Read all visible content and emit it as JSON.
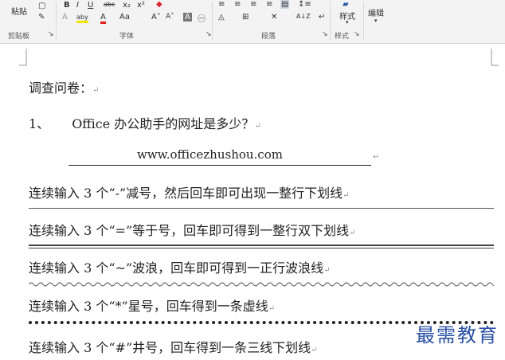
{
  "ribbon": {
    "paste_label": "粘贴",
    "clipboard_group": "剪贴板",
    "font_group": "字体",
    "paragraph_group": "段落",
    "styles_group": "样式",
    "styles_button": "样式",
    "edit_button": "编辑",
    "bold": "B",
    "italic": "I",
    "underline": "U",
    "strike": "abc",
    "subscript": "x₂",
    "superscript": "x²",
    "clear_format": "A",
    "highlight": "aby",
    "font_color": "A",
    "change_case": "Aa",
    "grow_font": "A˄",
    "shrink_font": "A˅",
    "char_border": "A",
    "enclose": "㊀",
    "sort": "A↓Z",
    "show_marks": "↵"
  },
  "document": {
    "heading": "调查问卷：",
    "q1_number": "1、",
    "q1_text": "Office 办公助手的网址是多少？",
    "answer_url": "www.officezhushou.com",
    "line1": "连续输入 3 个“-”减号，然后回车即可出现一整行下划线",
    "line2": "连续输入 3 个“=”等于号，回车即可得到一整行双下划线",
    "line3": "连续输入 3 个“~”波浪，回车即可得到一正行波浪线",
    "line4": "连续输入 3 个“*”星号，回车得到一条虚线",
    "line5": "连续输入 3 个“#”井号，回车得到一条三线下划线",
    "para_mark": "↵"
  },
  "watermark": "最需教育",
  "colors": {
    "font_color_red": "#e0201b",
    "highlight_yellow": "#f5e400",
    "watermark_blue": "#2a4fa3",
    "rule_gray": "#555555"
  }
}
